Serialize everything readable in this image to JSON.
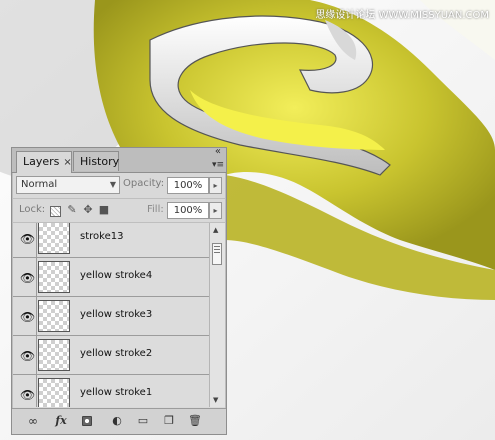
{
  "watermark": "思缘设计论坛 WWW.MISSYUAN.COM",
  "panel": {
    "tabs": [
      {
        "label": "Layers",
        "close": "×"
      },
      {
        "label": "History"
      }
    ],
    "collapse_glyph": "«",
    "menu_glyph": "▾≡",
    "blend_mode": "Normal",
    "opacity_label": "Opacity:",
    "opacity_value": "100%",
    "lock_label": "Lock:",
    "fill_label": "Fill:",
    "fill_value": "100%",
    "layers": [
      {
        "name": "stroke13",
        "visible": true
      },
      {
        "name": "yellow stroke4",
        "visible": true
      },
      {
        "name": "yellow stroke3",
        "visible": true
      },
      {
        "name": "yellow stroke2",
        "visible": true
      },
      {
        "name": "yellow stroke1",
        "visible": true
      }
    ],
    "bottom_icons": [
      "link-icon",
      "fx-icon",
      "mask-icon",
      "adjustment-icon",
      "group-folder-icon",
      "new-layer-icon",
      "trash-icon"
    ],
    "fx_label": "fx"
  },
  "colors": {
    "panel_bg": "#d9d9d9",
    "artwork_yellow": "#c4bf2a",
    "artwork_silver": "#e8e8e8"
  }
}
